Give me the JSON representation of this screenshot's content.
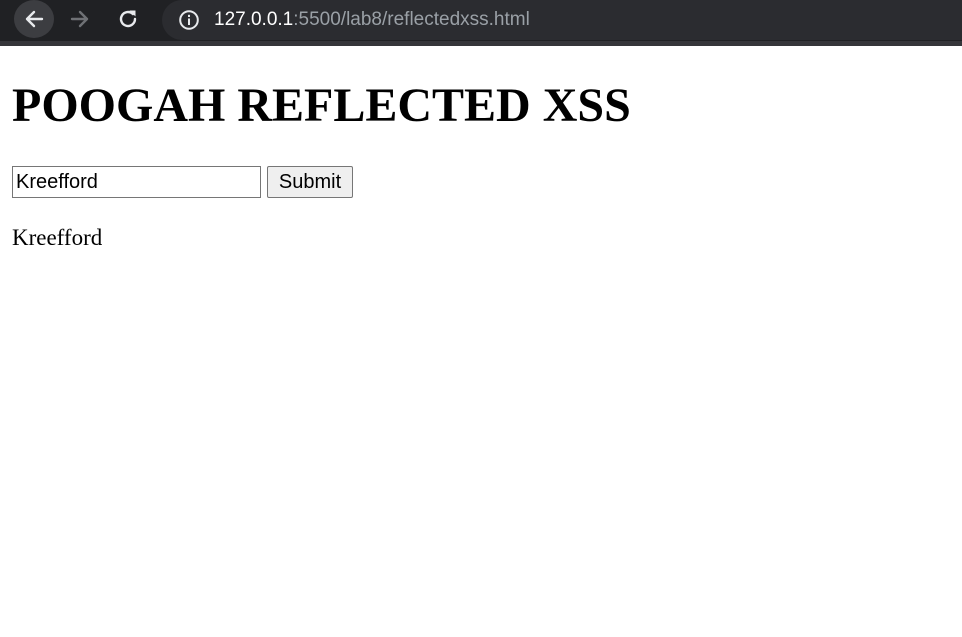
{
  "browser": {
    "url_host": "127.0.0.1",
    "url_rest": ":5500/lab8/reflectedxss.html",
    "icons": {
      "back": "arrow-left-icon",
      "forward": "arrow-right-icon",
      "reload": "reload-icon",
      "site_info": "info-icon"
    }
  },
  "page": {
    "title": "POOGAH REFLECTED XSS",
    "form": {
      "input_value": "Kreefford",
      "submit_label": "Submit"
    },
    "output_text": "Kreefford"
  }
}
